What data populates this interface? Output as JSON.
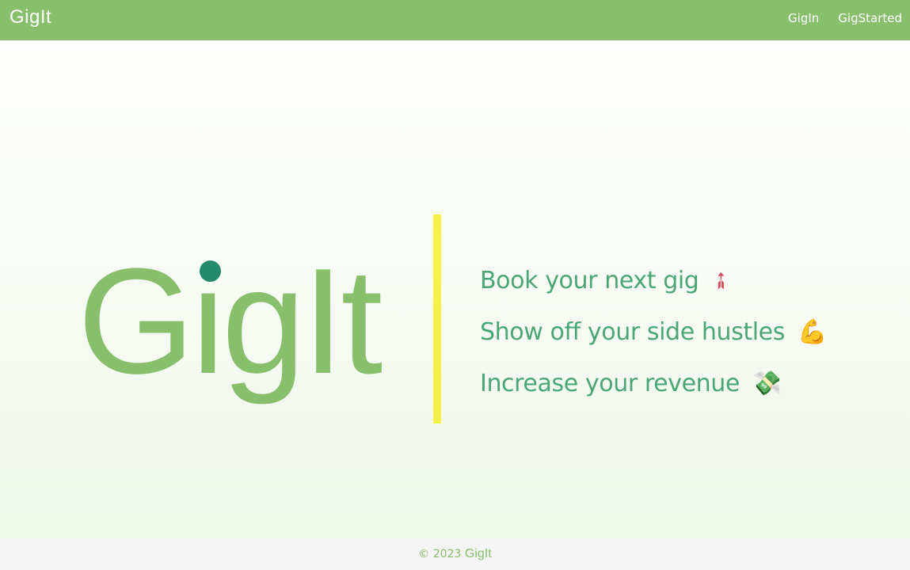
{
  "header": {
    "brand": "GigIt",
    "nav": [
      {
        "label": "GigIn"
      },
      {
        "label": "GigStarted"
      }
    ]
  },
  "hero": {
    "logo_text": "GigIt",
    "taglines": [
      {
        "text": "Book your next gig",
        "icon": "rocket-icon",
        "glyph": "➶"
      },
      {
        "text": "Show off your side hustles",
        "icon": "flexed-biceps-icon",
        "glyph": "💪"
      },
      {
        "text": "Increase your revenue",
        "icon": "money-with-wings-icon",
        "glyph": "💸"
      }
    ]
  },
  "footer": {
    "copyright": "© 2023",
    "brand": "GigIt"
  },
  "colors": {
    "header_bg": "#88bf6c",
    "brand_green": "#88bf6c",
    "tagline_green": "#4aa774",
    "dot": "#238a6c",
    "divider": "#f4f047",
    "footer_bg": "#f4f4f4"
  }
}
